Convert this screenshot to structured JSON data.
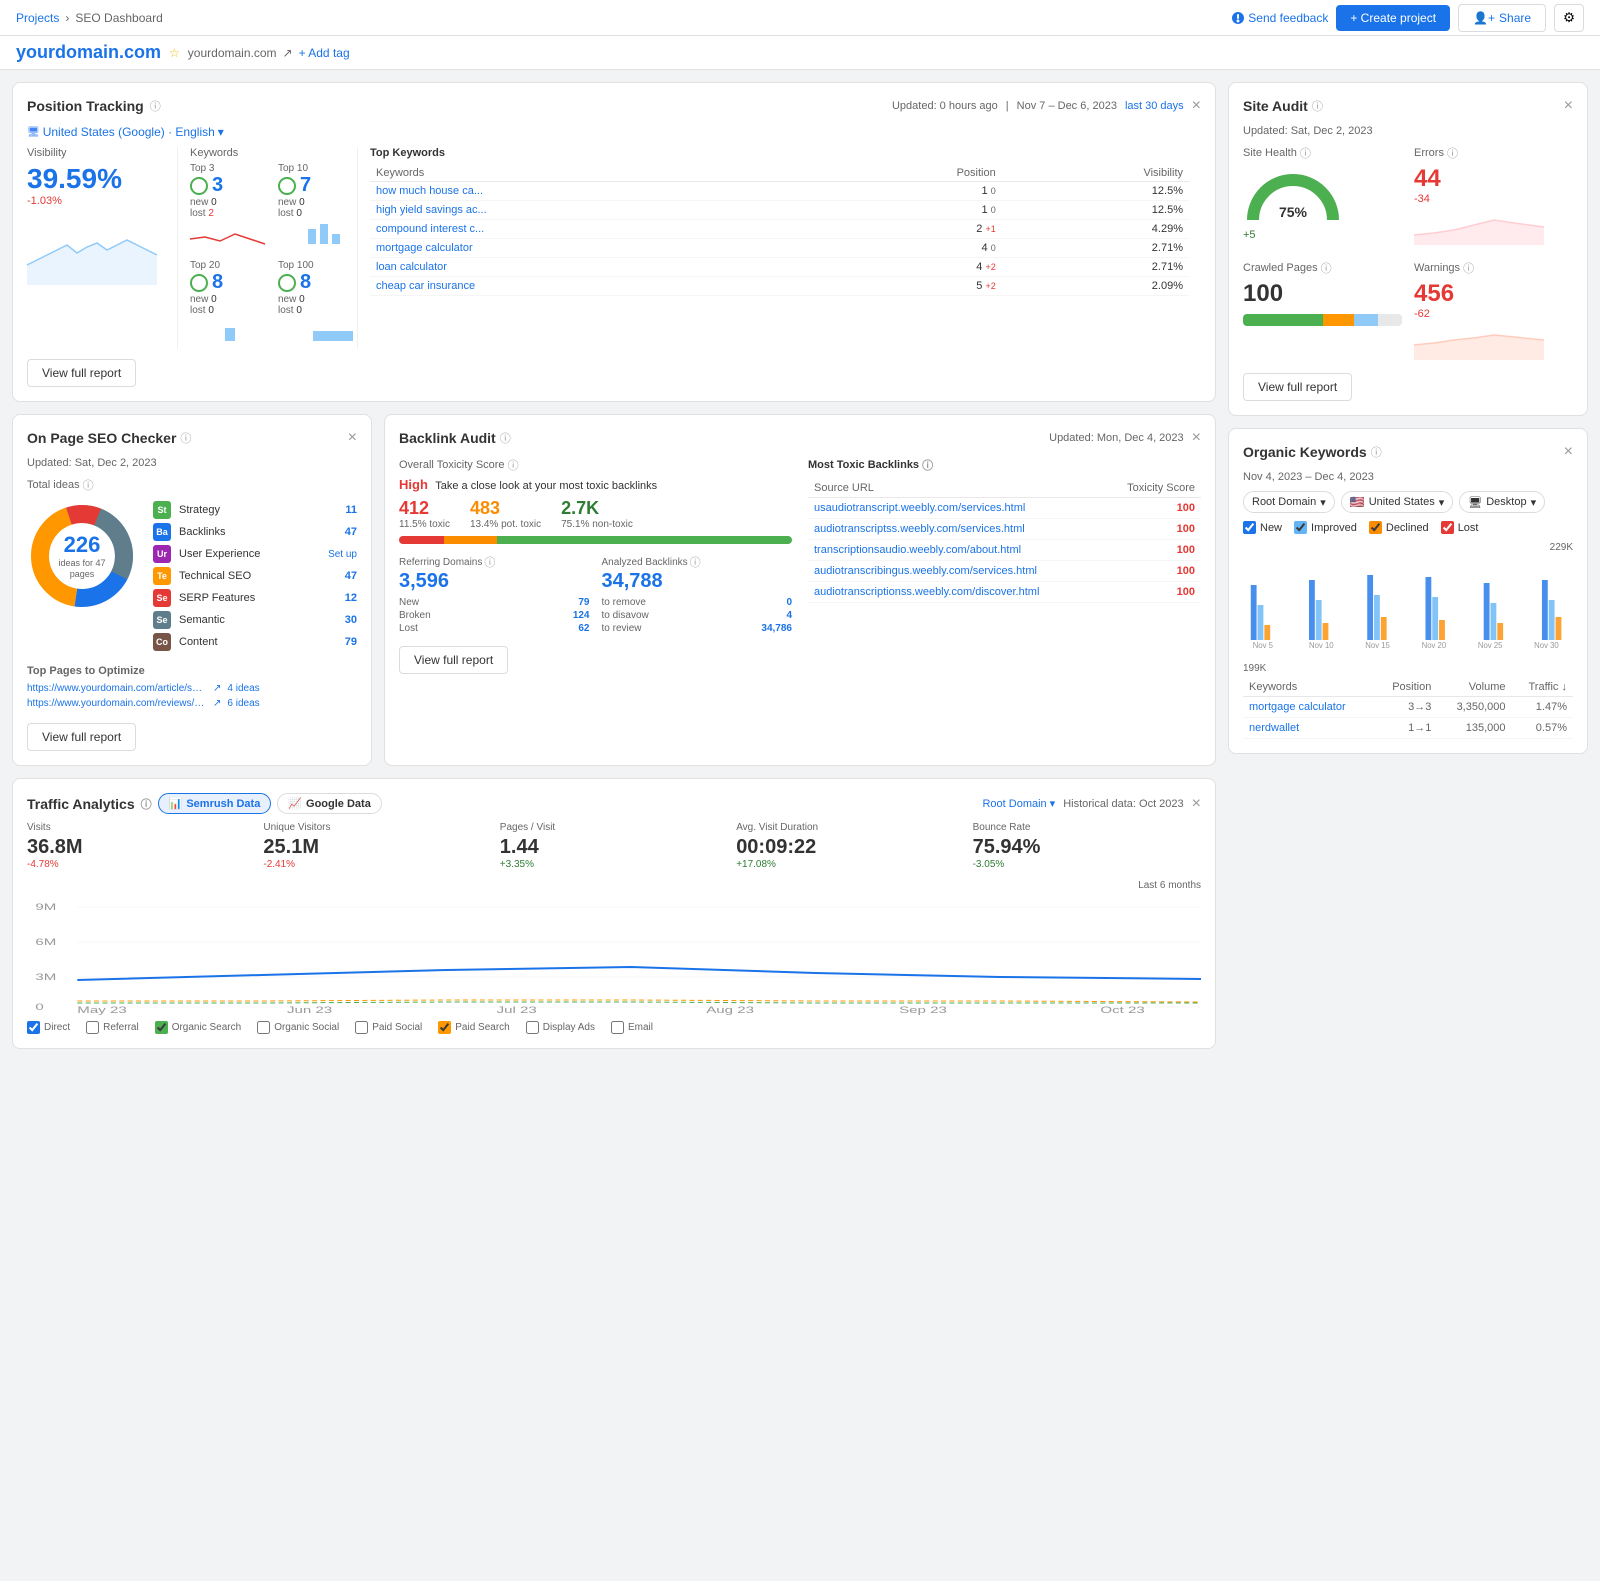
{
  "topbar": {
    "breadcrumb": [
      "Projects",
      "SEO Dashboard"
    ],
    "send_feedback": "Send feedback",
    "create_project": "+ Create project",
    "share": "Share"
  },
  "domain": {
    "name": "yourdomain.com",
    "url": "yourdomain.com",
    "add_tag": "+ Add tag"
  },
  "position_tracking": {
    "title": "Position Tracking",
    "updated": "Updated: 0 hours ago",
    "date_range": "Nov 7 – Dec 6, 2023",
    "filter": "last 30 days",
    "location": "United States (Google) · English",
    "visibility": {
      "label": "Visibility",
      "value": "39.59%",
      "change": "-1.03%"
    },
    "keywords": {
      "label": "Keywords",
      "top3": {
        "label": "Top 3",
        "value": "3",
        "new": "0",
        "lost": "2"
      },
      "top10": {
        "label": "Top 10",
        "value": "7",
        "new": "0",
        "lost": "0"
      },
      "top20": {
        "label": "Top 20",
        "value": "8",
        "new": "0",
        "lost": "0"
      },
      "top100": {
        "label": "Top 100",
        "value": "8",
        "new": "0",
        "lost": "0"
      }
    },
    "top_keywords": {
      "label": "Top Keywords",
      "headers": [
        "Keywords",
        "Position",
        "Visibility"
      ],
      "rows": [
        {
          "keyword": "how much house ca...",
          "position": "1",
          "change": "0",
          "visibility": "12.5%"
        },
        {
          "keyword": "high yield savings ac...",
          "position": "1",
          "change": "0",
          "visibility": "12.5%"
        },
        {
          "keyword": "compound interest c...",
          "position": "2",
          "change": "1",
          "visibility": "4.29%"
        },
        {
          "keyword": "mortgage calculator",
          "position": "4",
          "change": "0",
          "visibility": "2.71%"
        },
        {
          "keyword": "loan calculator",
          "position": "4",
          "change": "2",
          "visibility": "2.71%"
        },
        {
          "keyword": "cheap car insurance",
          "position": "5",
          "change": "2",
          "visibility": "2.09%"
        }
      ]
    },
    "view_report": "View full report"
  },
  "site_audit": {
    "title": "Site Audit",
    "updated": "Updated: Sat, Dec 2, 2023",
    "site_health": {
      "label": "Site Health",
      "value": "75%",
      "change": "+5"
    },
    "errors": {
      "label": "Errors",
      "value": "44",
      "change": "-34"
    },
    "crawled_pages": {
      "label": "Crawled Pages",
      "value": "100"
    },
    "warnings": {
      "label": "Warnings",
      "value": "456",
      "change": "-62"
    },
    "view_report": "View full report"
  },
  "on_page_seo": {
    "title": "On Page SEO Checker",
    "updated": "Updated: Sat, Dec 2, 2023",
    "total_ideas": {
      "label": "Total ideas",
      "value": "226",
      "sub": "ideas for 47 pages"
    },
    "ideas": [
      {
        "badge": "St",
        "color": "#4caf50",
        "name": "Strategy",
        "count": "11"
      },
      {
        "badge": "Ba",
        "color": "#1a73e8",
        "name": "Backlinks",
        "count": "47"
      },
      {
        "badge": "Ur",
        "color": "#9c27b0",
        "name": "User Experience",
        "count": "",
        "setup": "Set up"
      },
      {
        "badge": "Te",
        "color": "#ff9800",
        "name": "Technical SEO",
        "count": "47"
      },
      {
        "badge": "Se",
        "color": "#e53935",
        "name": "SERP Features",
        "count": "12"
      },
      {
        "badge": "Se",
        "color": "#607d8b",
        "name": "Semantic",
        "count": "30"
      },
      {
        "badge": "Co",
        "color": "#795548",
        "name": "Content",
        "count": "79"
      }
    ],
    "top_pages_label": "Top Pages to Optimize",
    "top_pages": [
      {
        "url": "https://www.yourdomain.com/article/small-business/how...",
        "count": "4 ideas"
      },
      {
        "url": "https://www.yourdomain.com/reviews/banking/chase",
        "count": "6 ideas"
      }
    ],
    "view_report": "View full report"
  },
  "backlink_audit": {
    "title": "Backlink Audit",
    "updated": "Updated: Mon, Dec 4, 2023",
    "toxicity": {
      "label": "Overall Toxicity Score",
      "level": "High",
      "subtitle": "Take a close look at your most toxic backlinks",
      "toxic": "412",
      "toxic_label": "11.5% toxic",
      "pot_toxic": "483",
      "pot_toxic_label": "13.4% pot. toxic",
      "non_toxic": "2.7K",
      "non_toxic_label": "75.1% non-toxic",
      "bar_toxic_pct": 11.5,
      "bar_pot_pct": 13.4,
      "bar_non_pct": 75.1
    },
    "referring_domains": {
      "label": "Referring Domains",
      "value": "3,596",
      "new": "79",
      "broken": "124",
      "lost": "62"
    },
    "analyzed_backlinks": {
      "label": "Analyzed Backlinks",
      "value": "34,788",
      "to_remove": "0",
      "to_disavow": "4",
      "to_review": "34,786"
    },
    "most_toxic": {
      "label": "Most Toxic Backlinks",
      "headers": [
        "Source URL",
        "Toxicity Score"
      ],
      "rows": [
        {
          "url": "usaudiotranscript.weebly.com/services.html",
          "score": "100"
        },
        {
          "url": "audiotranscriptss.weebly.com/services.html",
          "score": "100"
        },
        {
          "url": "transcriptionsaudio.weebly.com/about.html",
          "score": "100"
        },
        {
          "url": "audiotranscribingus.weebly.com/services.html",
          "score": "100"
        },
        {
          "url": "audiotranscriptionss.weebly.com/discover.html",
          "score": "100"
        }
      ]
    },
    "view_report": "View full report"
  },
  "traffic_analytics": {
    "title": "Traffic Analytics",
    "tabs": [
      "Semrush Data",
      "Google Data"
    ],
    "active_tab": 0,
    "filters": {
      "root_domain": "Root Domain",
      "historical": "Historical data: Oct 2023"
    },
    "metrics": [
      {
        "label": "Visits",
        "value": "36.8M",
        "change": "-4.78%"
      },
      {
        "label": "Unique Visitors",
        "value": "25.1M",
        "change": "-2.41%"
      },
      {
        "label": "Pages / Visit",
        "value": "1.44",
        "change": "+3.35%",
        "pos": true
      },
      {
        "label": "Avg. Visit Duration",
        "value": "00:09:22",
        "change": "+17.08%",
        "pos": true
      },
      {
        "label": "Bounce Rate",
        "value": "75.94%",
        "change": "-3.05%",
        "pos": true
      }
    ],
    "chart": {
      "x_labels": [
        "May 23",
        "Jun 23",
        "Jul 23",
        "Aug 23",
        "Sep 23",
        "Oct 23"
      ],
      "y_labels": [
        "9M",
        "6M",
        "3M",
        "0"
      ],
      "last_6m": "Last 6 months"
    },
    "legend": [
      "Direct",
      "Referral",
      "Organic Search",
      "Organic Social",
      "Paid Social",
      "Paid Search",
      "Display Ads",
      "Email"
    ]
  },
  "organic_keywords": {
    "title": "Organic Keywords",
    "date_range": "Nov 4, 2023 – Dec 4, 2023",
    "filters": {
      "root_domain": "Root Domain",
      "country": "United States",
      "device": "Desktop"
    },
    "legend": [
      "New",
      "Improved",
      "Declined",
      "Lost"
    ],
    "chart": {
      "y_max": "229K",
      "y_min": "199K",
      "x_labels": [
        "Nov 5",
        "Nov 10",
        "Nov 15",
        "Nov 20",
        "Nov 25",
        "Nov 30"
      ]
    },
    "table": {
      "headers": [
        "Keywords",
        "Position",
        "Volume",
        "Traffic"
      ],
      "rows": [
        {
          "keyword": "mortgage calculator",
          "position": "3→3",
          "volume": "3,350,000",
          "traffic": "1.47%"
        },
        {
          "keyword": "nerdwallet",
          "position": "1→1",
          "volume": "135,000",
          "traffic": "0.57%"
        }
      ]
    }
  }
}
